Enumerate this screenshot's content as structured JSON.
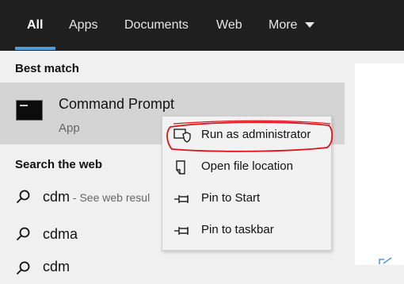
{
  "tabs": [
    {
      "label": "All",
      "active": true
    },
    {
      "label": "Apps"
    },
    {
      "label": "Documents"
    },
    {
      "label": "Web"
    },
    {
      "label": "More"
    }
  ],
  "best_match": {
    "heading": "Best match",
    "title": "Command Prompt",
    "subtitle": "App"
  },
  "search_web": {
    "heading": "Search the web",
    "results": [
      {
        "query": "cdm",
        "hint": " - See web resul"
      },
      {
        "query": "cdma",
        "hint": ""
      },
      {
        "query": "cdm",
        "hint": ""
      }
    ]
  },
  "context_menu": {
    "items": [
      {
        "label": "Run as administrator",
        "icon": "shield-icon",
        "highlighted": true
      },
      {
        "label": "Open file location",
        "icon": "file-location-icon"
      },
      {
        "label": "Pin to Start",
        "icon": "pin-icon"
      },
      {
        "label": "Pin to taskbar",
        "icon": "pin-icon"
      }
    ]
  },
  "colors": {
    "tabbar": "#1f1f1f",
    "accent": "#4f9cd9",
    "selection": "#d4d4d4",
    "annotation": "#e0121b"
  }
}
